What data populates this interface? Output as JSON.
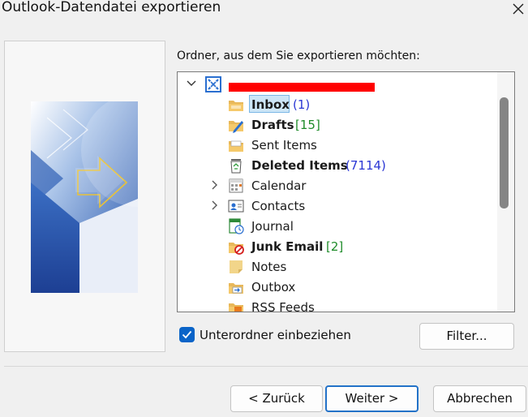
{
  "window": {
    "title": "Outlook-Datendatei exportieren",
    "close_icon": "close-icon"
  },
  "main": {
    "folder_prompt": "Ordner, aus dem Sie exportieren möchten:",
    "tree": {
      "root": {
        "label": "",
        "icon": "exchange-icon",
        "expanded": true,
        "redacted": true
      },
      "items": [
        {
          "label": "Inbox",
          "count": "(1)",
          "bold": true,
          "count_color": "blue",
          "selected": true,
          "icon": "inbox-folder-icon",
          "expandable": false
        },
        {
          "label": "Drafts",
          "count": "[15]",
          "bold": true,
          "count_color": "green",
          "selected": false,
          "icon": "drafts-folder-icon",
          "expandable": false
        },
        {
          "label": "Sent Items",
          "count": "",
          "bold": false,
          "count_color": "",
          "selected": false,
          "icon": "sent-folder-icon",
          "expandable": false
        },
        {
          "label": "Deleted Items",
          "count": "(7114)",
          "bold": true,
          "count_color": "blue",
          "selected": false,
          "icon": "recycle-bin-icon",
          "expandable": false
        },
        {
          "label": "Calendar",
          "count": "",
          "bold": false,
          "count_color": "",
          "selected": false,
          "icon": "calendar-icon",
          "expandable": true
        },
        {
          "label": "Contacts",
          "count": "",
          "bold": false,
          "count_color": "",
          "selected": false,
          "icon": "contacts-icon",
          "expandable": true
        },
        {
          "label": "Journal",
          "count": "",
          "bold": false,
          "count_color": "",
          "selected": false,
          "icon": "journal-icon",
          "expandable": false
        },
        {
          "label": "Junk Email",
          "count": "[2]",
          "bold": true,
          "count_color": "green",
          "selected": false,
          "icon": "junk-folder-icon",
          "expandable": false
        },
        {
          "label": "Notes",
          "count": "",
          "bold": false,
          "count_color": "",
          "selected": false,
          "icon": "notes-icon",
          "expandable": false
        },
        {
          "label": "Outbox",
          "count": "",
          "bold": false,
          "count_color": "",
          "selected": false,
          "icon": "outbox-folder-icon",
          "expandable": false
        },
        {
          "label": "RSS Feeds",
          "count": "",
          "bold": false,
          "count_color": "",
          "selected": false,
          "icon": "rss-folder-icon",
          "expandable": false
        }
      ]
    },
    "include_subfolders": {
      "label": "Unterordner einbeziehen",
      "checked": true
    },
    "filter_button": "Filter..."
  },
  "footer": {
    "back_button": "< Zurück",
    "next_button": "Weiter >",
    "cancel_button": "Abbrechen"
  },
  "colors": {
    "accent": "#0a64c8",
    "selection_bg": "#cde6f7",
    "count_blue": "#2a36d4",
    "count_green": "#1f8c2a",
    "redaction": "#ff0000"
  }
}
